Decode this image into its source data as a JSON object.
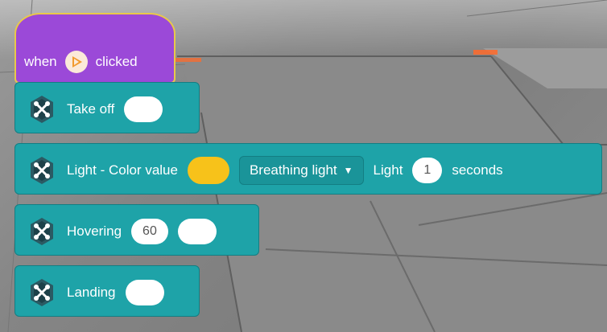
{
  "hat": {
    "when_label": "when",
    "clicked_label": "clicked",
    "icon": "play-flag-icon"
  },
  "blocks": [
    {
      "label": "Take off",
      "icon": "drone-icon",
      "slot": ""
    },
    {
      "label": "Light - Color value",
      "icon": "drone-icon",
      "color_value": "#f7c21a",
      "mode": "Breathing light",
      "light_label": "Light",
      "duration": "1",
      "unit": "seconds"
    },
    {
      "label": "Hovering",
      "icon": "drone-icon",
      "value": "60",
      "slot": ""
    },
    {
      "label": "Landing",
      "icon": "drone-icon",
      "slot": ""
    }
  ],
  "colors": {
    "event_block": "#9b49d8",
    "command_block": "#1ea3a8",
    "color_swatch": "#f7c21a"
  }
}
